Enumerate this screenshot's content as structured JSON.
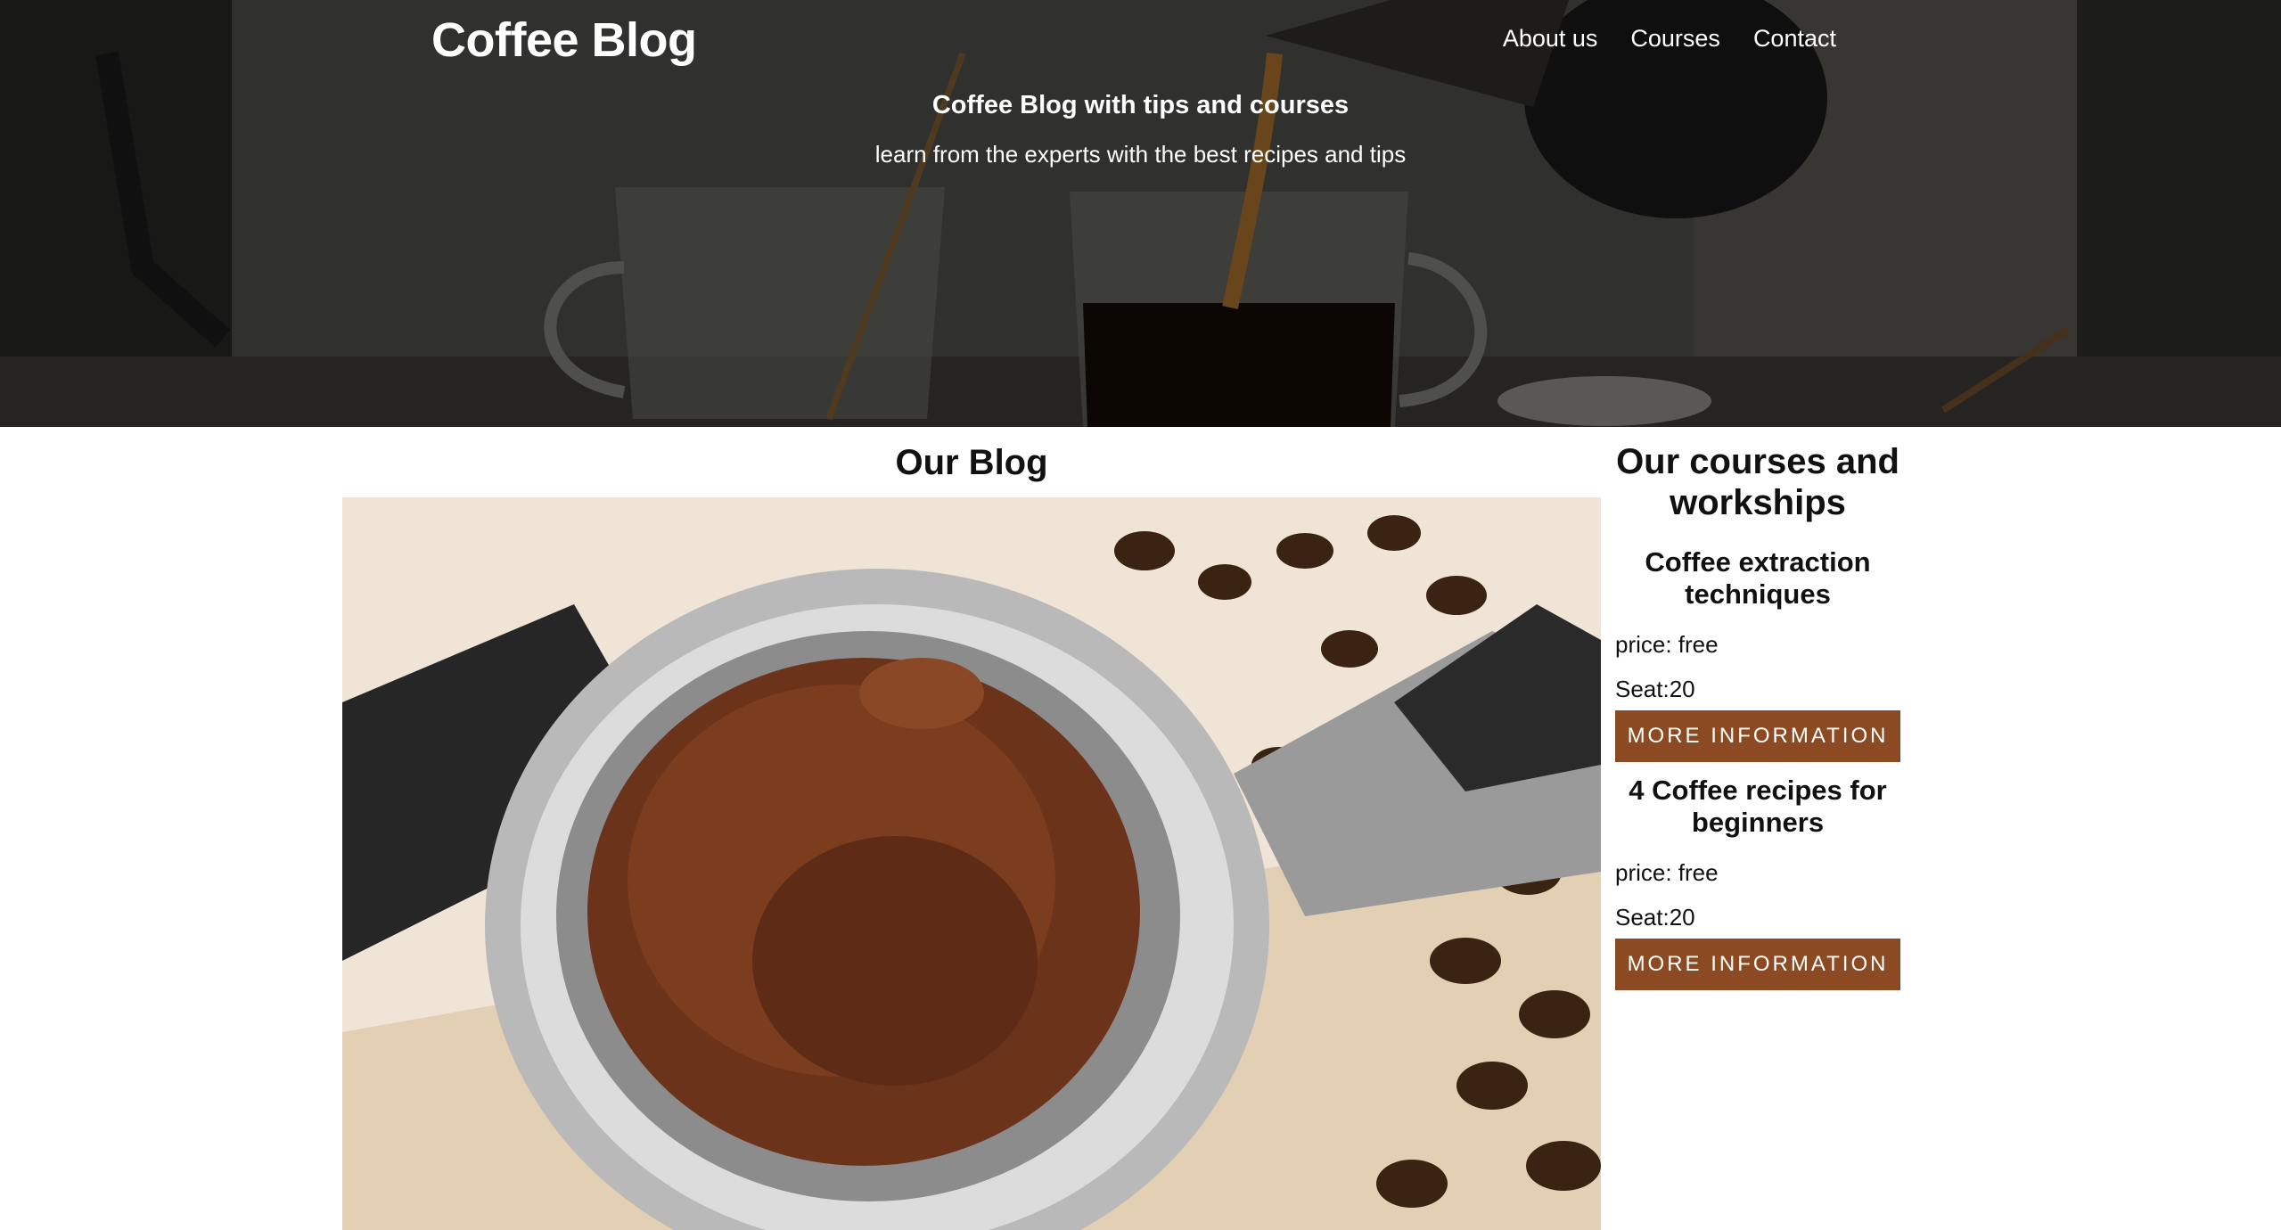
{
  "header": {
    "site_title": "Coffee Blog",
    "nav": [
      "About us",
      "Courses",
      "Contact"
    ],
    "hero_heading": "Coffee Blog with tips and courses",
    "hero_subheading": "learn from the experts with the best recipes and tips"
  },
  "blog": {
    "title": "Our Blog"
  },
  "courses": {
    "title": "Our courses and workships",
    "items": [
      {
        "name": "Coffee extraction techniques",
        "price": "price: free",
        "seats": "Seat:20",
        "button": "MORE INFORMATION"
      },
      {
        "name": "4 Coffee recipes for beginners",
        "price": "price: free",
        "seats": "Seat:20",
        "button": "MORE INFORMATION"
      }
    ]
  },
  "colors": {
    "accent": "#8b4a22",
    "hero_overlay": "#000000",
    "text": "#111111"
  }
}
